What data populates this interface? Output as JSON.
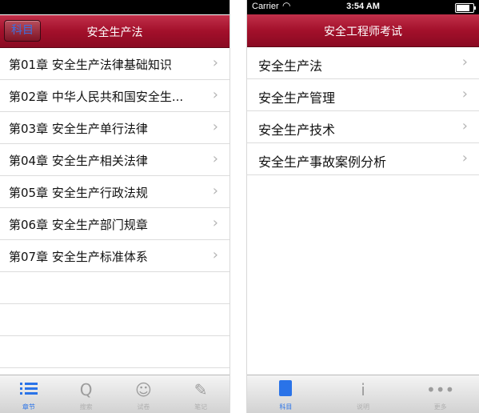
{
  "left_screen": {
    "nav": {
      "back_label": "科目",
      "title": "安全生产法"
    },
    "chapters": [
      "第01章 安全生产法律基础知识",
      "第02章 中华人民共和国安全生...",
      "第03章 安全生产单行法律",
      "第04章 安全生产相关法律",
      "第05章 安全生产行政法规",
      "第06章 安全生产部门规章",
      "第07章 安全生产标准体系"
    ],
    "empty_rows": 3,
    "tabs": [
      {
        "icon": "list-icon",
        "label": "章节",
        "active": true
      },
      {
        "icon": "q-icon",
        "label": "搜索",
        "active": false
      },
      {
        "icon": "exam-icon",
        "label": "试卷",
        "active": false
      },
      {
        "icon": "edit-icon",
        "label": "笔记",
        "active": false
      }
    ]
  },
  "right_screen": {
    "status": {
      "carrier": "Carrier",
      "time": "3:54 AM",
      "battery_level": 0.9
    },
    "nav": {
      "title": "安全工程师考试"
    },
    "subjects": [
      "安全生产法",
      "安全生产管理",
      "安全生产技术",
      "安全生产事故案例分析"
    ],
    "tabs": [
      {
        "icon": "book-icon",
        "label": "科目",
        "active": true
      },
      {
        "icon": "info-icon",
        "label": "说明",
        "active": false
      },
      {
        "icon": "more-icon",
        "label": "更多",
        "active": false
      }
    ]
  },
  "colors": {
    "navbar": "#a3102b",
    "accent": "#2a73e8"
  }
}
